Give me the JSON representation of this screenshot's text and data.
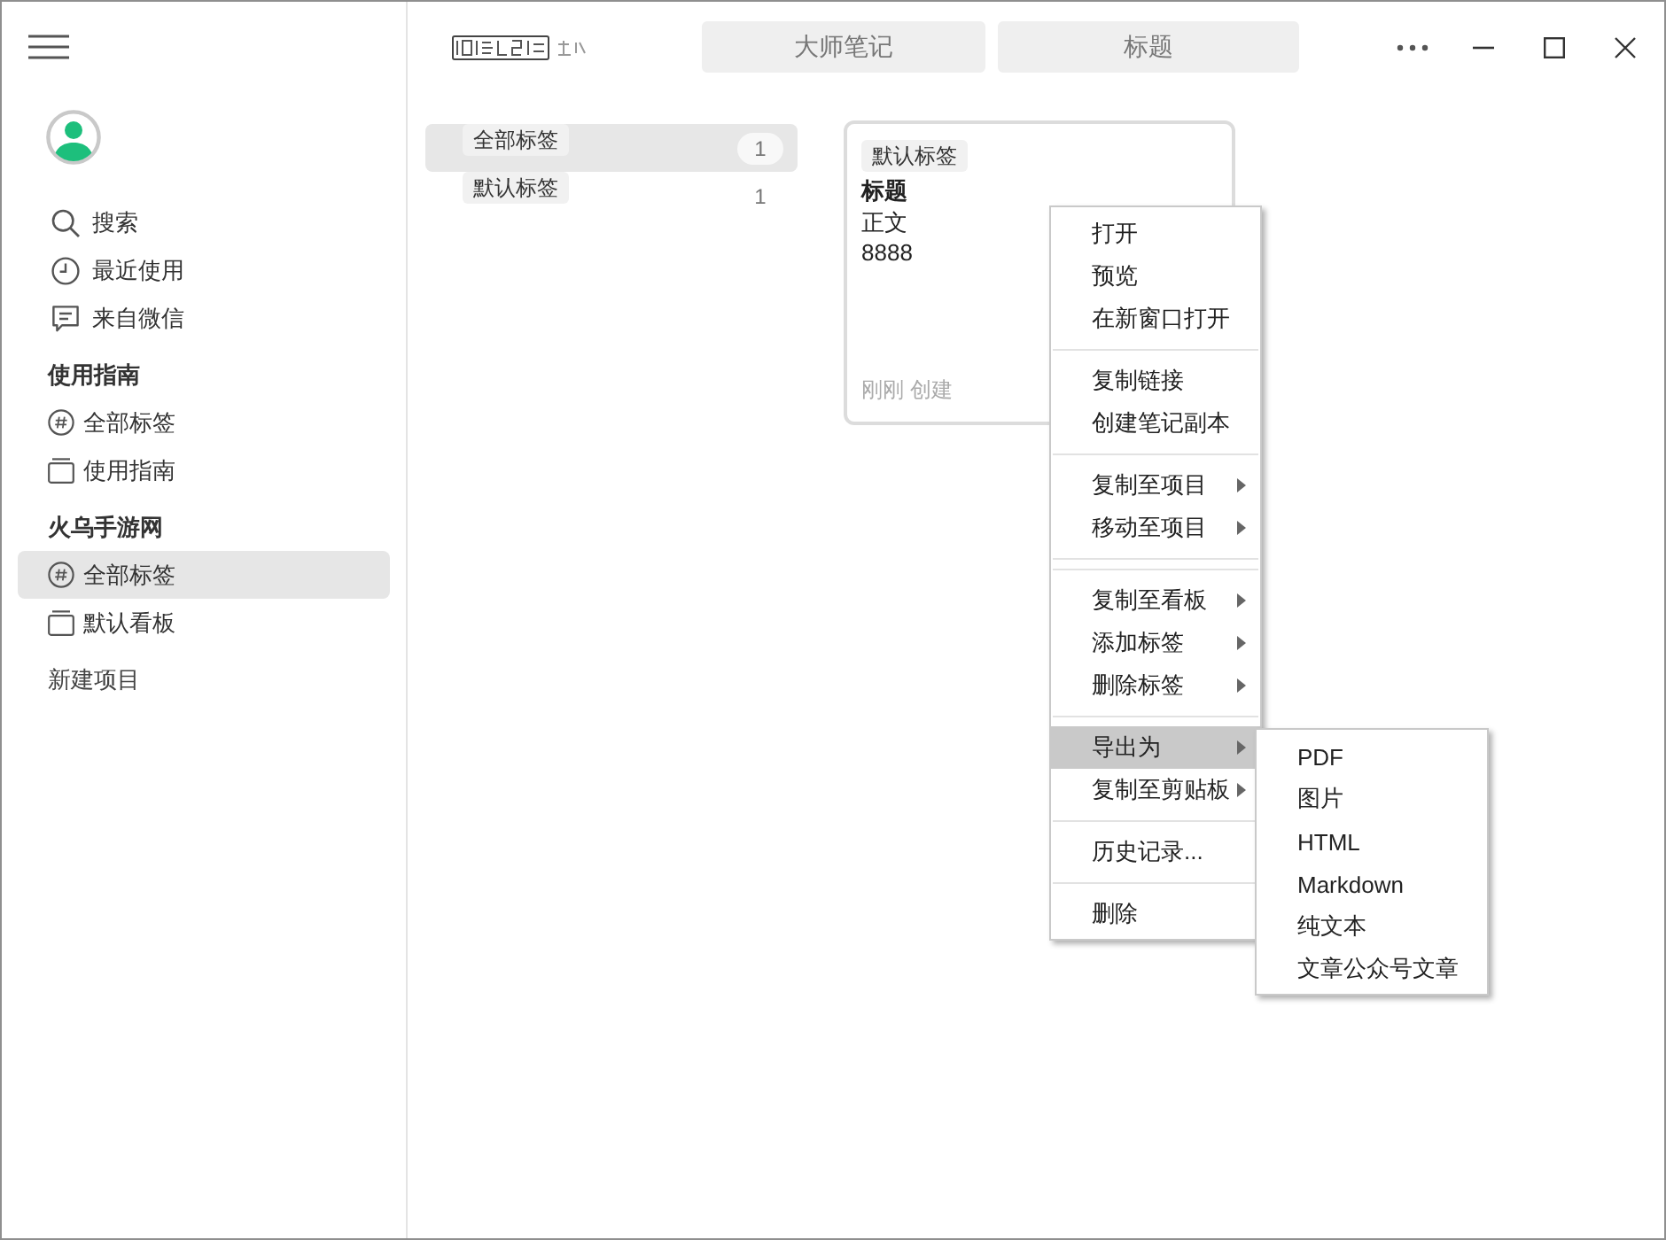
{
  "sidebar": {
    "nav": [
      {
        "label": "搜索",
        "selected": false
      },
      {
        "label": "最近使用",
        "selected": false
      },
      {
        "label": "来自微信",
        "selected": false
      }
    ],
    "projects": [
      {
        "title": "使用指南",
        "items": [
          {
            "kind": "tags",
            "label": "全部标签",
            "selected": false
          },
          {
            "kind": "board",
            "label": "使用指南",
            "selected": false
          }
        ]
      },
      {
        "title": "火乌手游网",
        "items": [
          {
            "kind": "tags",
            "label": "全部标签",
            "selected": true
          },
          {
            "kind": "board",
            "label": "默认看板",
            "selected": false
          }
        ]
      }
    ],
    "new_project": "新建项目"
  },
  "tabs": [
    {
      "label": "大师笔记",
      "selected": false
    },
    {
      "label": "标题",
      "selected": false
    }
  ],
  "tag_list": [
    {
      "label": "全部标签",
      "count": "1",
      "selected": true
    },
    {
      "label": "默认标签",
      "count": "1",
      "selected": false
    }
  ],
  "note_card": {
    "tag": "默认标签",
    "title": "标题",
    "body": [
      "正文",
      "8888"
    ],
    "footer": "刚刚 创建"
  },
  "context_menu": {
    "items": [
      {
        "kind": "item",
        "label": "打开",
        "has_submenu": false,
        "selected": false
      },
      {
        "kind": "item",
        "label": "预览",
        "has_submenu": false,
        "selected": false
      },
      {
        "kind": "item",
        "label": "在新窗口打开",
        "has_submenu": false,
        "selected": false
      },
      {
        "kind": "separator"
      },
      {
        "kind": "item",
        "label": "复制链接",
        "has_submenu": false,
        "selected": false
      },
      {
        "kind": "item",
        "label": "创建笔记副本",
        "has_submenu": false,
        "selected": false
      },
      {
        "kind": "separator"
      },
      {
        "kind": "item",
        "label": "复制至项目",
        "has_submenu": true,
        "selected": false
      },
      {
        "kind": "item",
        "label": "移动至项目",
        "has_submenu": true,
        "selected": false
      },
      {
        "kind": "separator"
      },
      {
        "kind": "separator"
      },
      {
        "kind": "item",
        "label": "复制至看板",
        "has_submenu": true,
        "selected": false
      },
      {
        "kind": "item",
        "label": "添加标签",
        "has_submenu": true,
        "selected": false
      },
      {
        "kind": "item",
        "label": "删除标签",
        "has_submenu": true,
        "selected": false
      },
      {
        "kind": "separator"
      },
      {
        "kind": "item",
        "label": "导出为",
        "has_submenu": true,
        "selected": true
      },
      {
        "kind": "item",
        "label": "复制至剪贴板",
        "has_submenu": true,
        "selected": false
      },
      {
        "kind": "separator"
      },
      {
        "kind": "item",
        "label": "历史记录...",
        "has_submenu": false,
        "selected": false
      },
      {
        "kind": "separator"
      },
      {
        "kind": "item",
        "label": "删除",
        "has_submenu": false,
        "selected": false
      }
    ],
    "submenu": {
      "items": [
        {
          "label": "PDF"
        },
        {
          "label": "图片"
        },
        {
          "label": "HTML"
        },
        {
          "label": "Markdown"
        },
        {
          "label": "纯文本"
        },
        {
          "label": "文章公众号文章"
        }
      ]
    }
  }
}
